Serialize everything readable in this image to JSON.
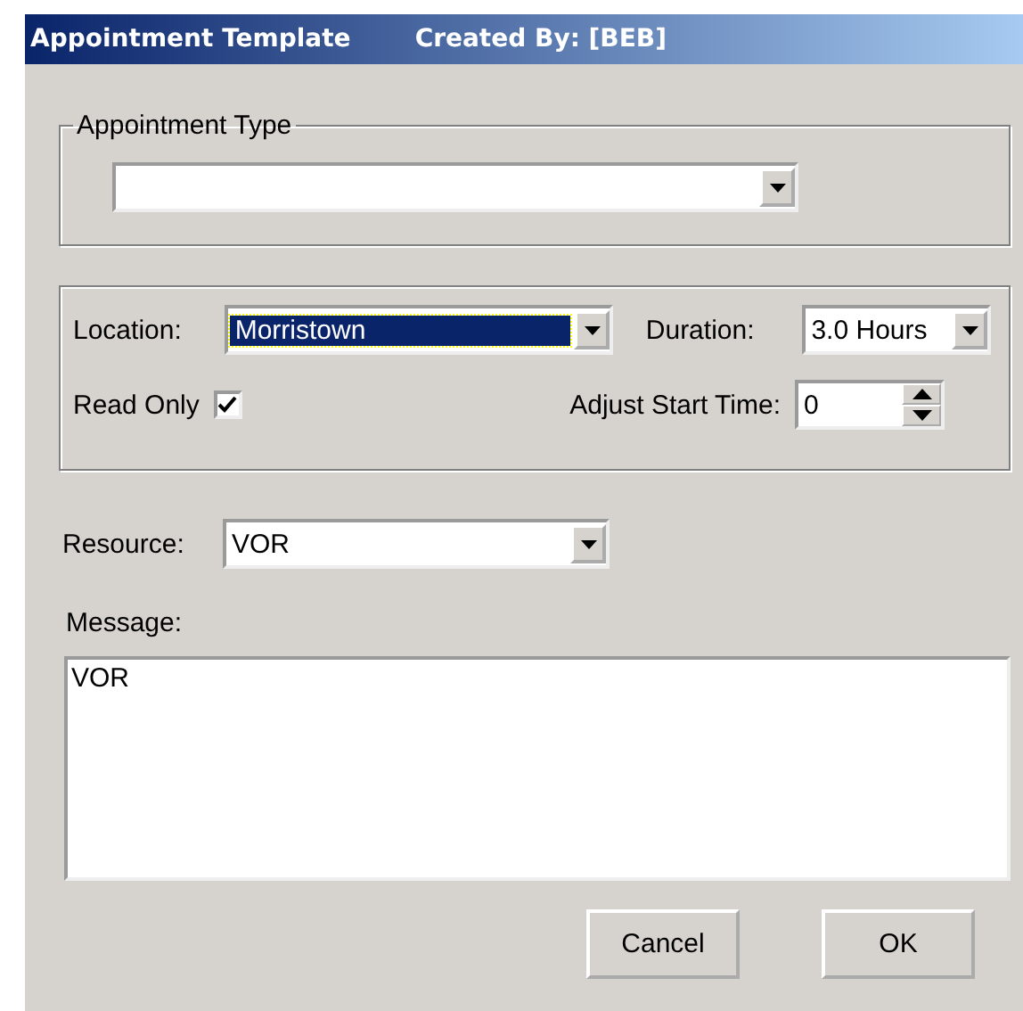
{
  "window": {
    "title": "Appointment Template",
    "created_by": "Created By: [BEB]"
  },
  "appointment_type": {
    "legend": "Appointment Type"
  },
  "location": {
    "label": "Location:",
    "value": "Morristown",
    "focused": true
  },
  "duration": {
    "label": "Duration:",
    "value": "3.0 Hours"
  },
  "read_only": {
    "label": "Read Only",
    "checked": true
  },
  "adjust_start_time": {
    "label": "Adjust Start Time:",
    "value": "0"
  },
  "resource": {
    "label": "Resource:",
    "value": "VOR"
  },
  "message": {
    "label": "Message:",
    "value": "VOR"
  },
  "buttons": [
    {
      "label": "Cancel"
    },
    {
      "label": "OK"
    }
  ]
}
